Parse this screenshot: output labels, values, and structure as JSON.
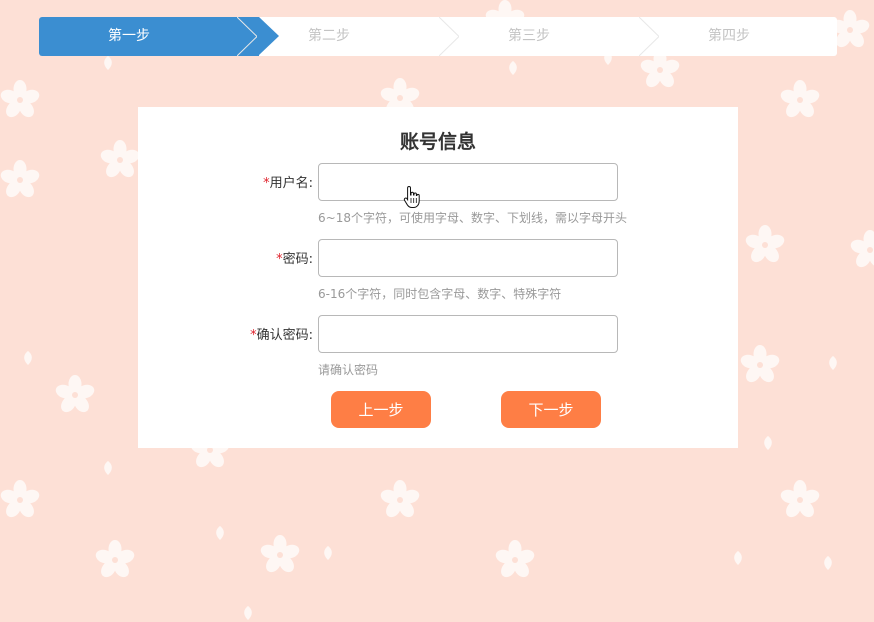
{
  "steps": [
    {
      "label": "第一步",
      "active": true
    },
    {
      "label": "第二步",
      "active": false
    },
    {
      "label": "第三步",
      "active": false
    },
    {
      "label": "第四步",
      "active": false
    }
  ],
  "form": {
    "title": "账号信息",
    "required_mark": "*",
    "fields": [
      {
        "label": "用户名:",
        "value": "",
        "placeholder": "",
        "hint": "6~18个字符，可使用字母、数字、下划线，需以字母开头"
      },
      {
        "label": "密码:",
        "value": "",
        "placeholder": "",
        "hint": "6-16个字符，同时包含字母、数字、特殊字符"
      },
      {
        "label": "确认密码:",
        "value": "",
        "placeholder": "",
        "hint": "请确认密码"
      }
    ]
  },
  "buttons": {
    "prev_label": "上一步",
    "next_label": "下一步"
  },
  "colors": {
    "background": "#fde0d6",
    "step_active": "#3b8ed1",
    "button": "#fe7e45",
    "required": "#e0222c"
  },
  "icons": {
    "cursor": "hand-pointer-icon",
    "decoration": "cherry-blossom-icon"
  }
}
